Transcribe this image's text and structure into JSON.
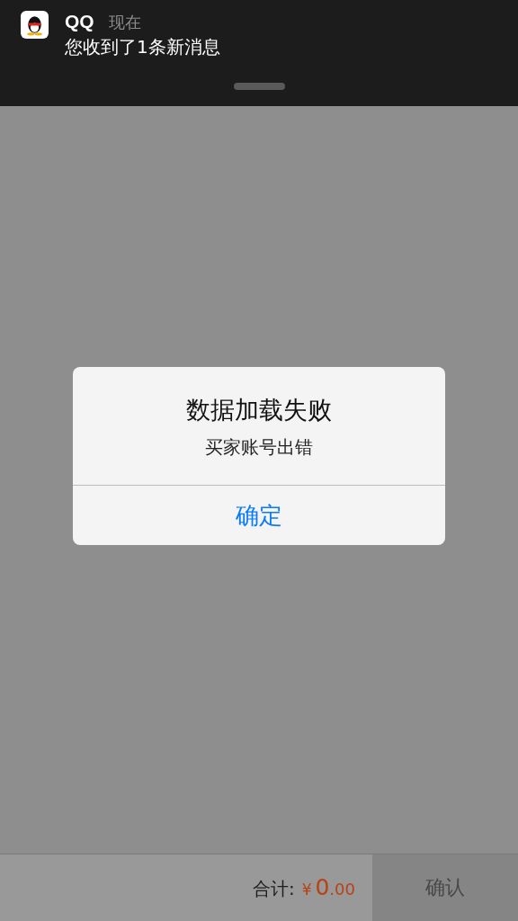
{
  "notification": {
    "app": "QQ",
    "time": "现在",
    "message": "您收到了1条新消息"
  },
  "alert": {
    "title": "数据加载失败",
    "message": "买家账号出错",
    "buttons": [
      "确定"
    ]
  },
  "footer": {
    "total_label": "合计:",
    "currency": "¥",
    "amount_integer": "0",
    "amount_decimal": ".00",
    "confirm": {
      "label": "确认",
      "disabled": true
    }
  }
}
